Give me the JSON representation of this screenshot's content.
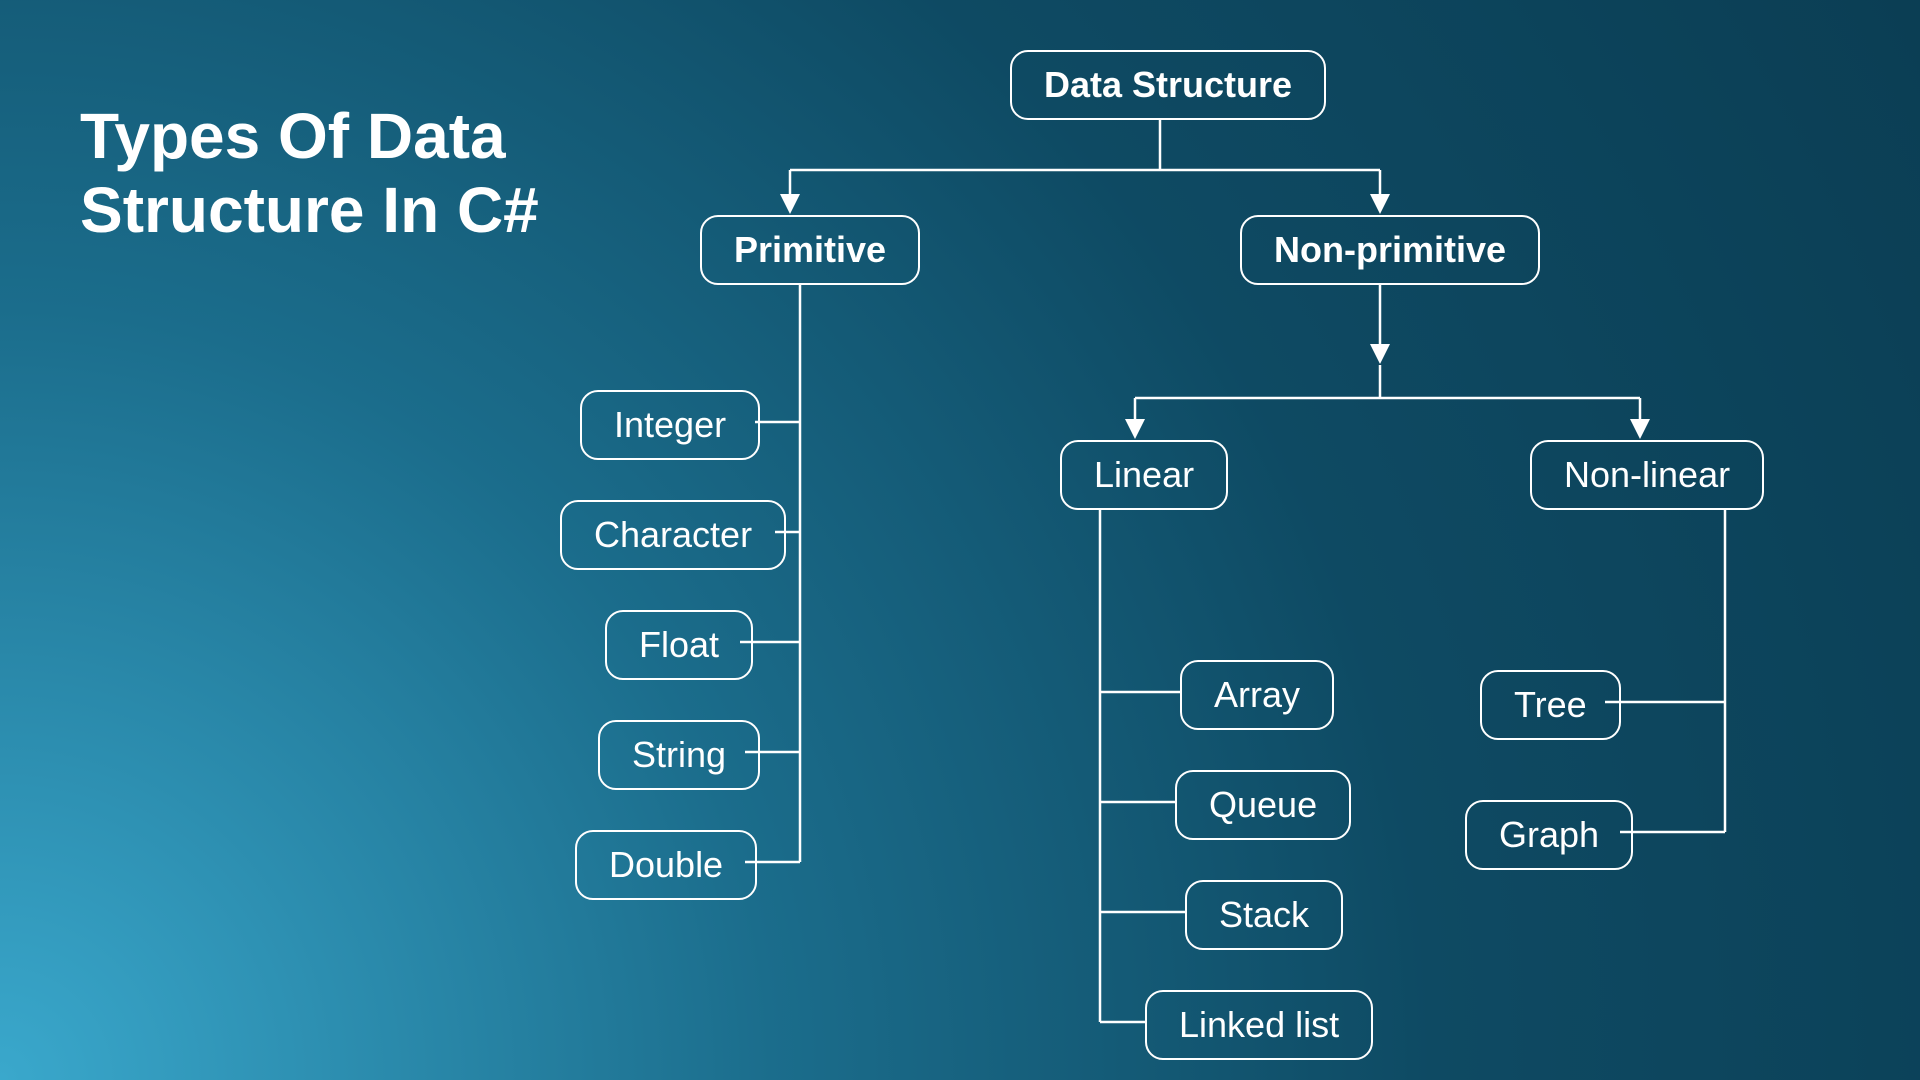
{
  "title_line1": "Types Of Data",
  "title_line2": "Structure In C#",
  "nodes": {
    "root": "Data Structure",
    "primitive": "Primitive",
    "nonprimitive": "Non-primitive",
    "integer": "Integer",
    "character": "Character",
    "float": "Float",
    "string": "String",
    "double": "Double",
    "linear": "Linear",
    "nonlinear": "Non-linear",
    "array": "Array",
    "queue": "Queue",
    "stack": "Stack",
    "linkedlist": "Linked list",
    "tree": "Tree",
    "graph": "Graph"
  }
}
